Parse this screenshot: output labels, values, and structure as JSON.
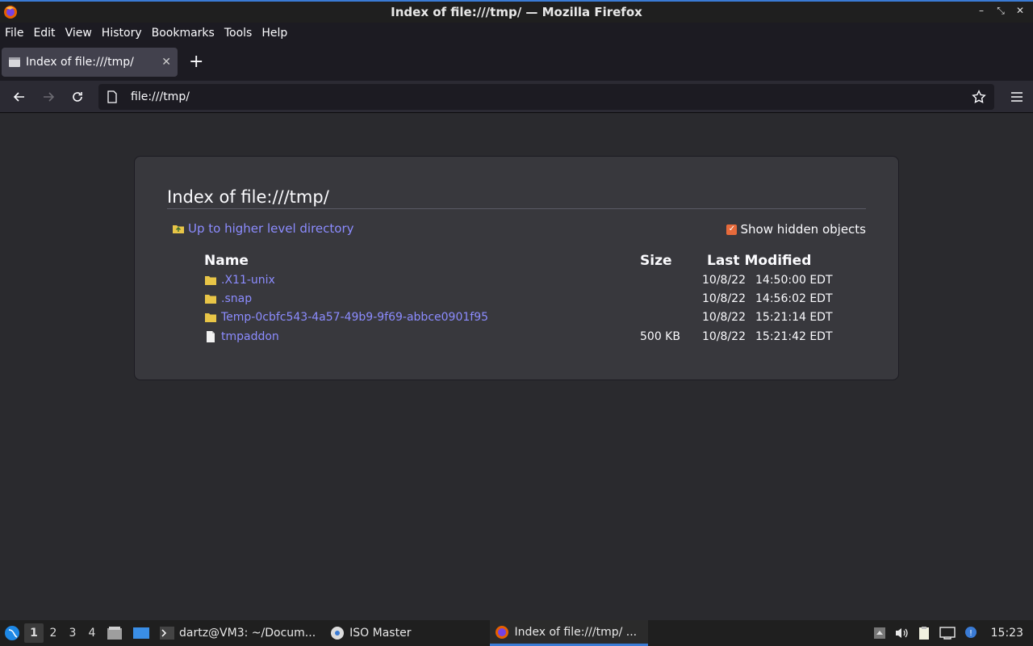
{
  "window": {
    "title": "Index of file:///tmp/ — Mozilla Firefox",
    "controls": [
      "–",
      "⤡",
      "✕"
    ]
  },
  "menubar": {
    "items": [
      "File",
      "Edit",
      "View",
      "History",
      "Bookmarks",
      "Tools",
      "Help"
    ]
  },
  "tab": {
    "label": "Index of file:///tmp/",
    "close": "✕",
    "new_tab": "+"
  },
  "navbar": {
    "url": "file:///tmp/"
  },
  "page": {
    "heading": "Index of file:///tmp/",
    "up_link": "Up to higher level directory",
    "show_hidden_label": "Show hidden objects",
    "show_hidden_checked": true,
    "columns": {
      "name": "Name",
      "size": "Size",
      "modified": "Last Modified"
    },
    "entries": [
      {
        "name": ".X11-unix",
        "type": "folder",
        "size": "",
        "date": "10/8/22",
        "time": "14:50:00 EDT"
      },
      {
        "name": ".snap",
        "type": "folder",
        "size": "",
        "date": "10/8/22",
        "time": "14:56:02 EDT"
      },
      {
        "name": "Temp-0cbfc543-4a57-49b9-9f69-abbce0901f95",
        "type": "folder",
        "size": "",
        "date": "10/8/22",
        "time": "15:21:14 EDT"
      },
      {
        "name": "tmpaddon",
        "type": "file",
        "size": "500 KB",
        "date": "10/8/22",
        "time": "15:21:42 EDT"
      }
    ]
  },
  "taskbar": {
    "workspaces": [
      "1",
      "2",
      "3",
      "4"
    ],
    "tasks": [
      {
        "label": "dartz@VM3: ~/Docum...",
        "icon": "terminal-icon"
      },
      {
        "label": "ISO Master",
        "icon": "iso-master-icon"
      },
      {
        "label": "Index of file:///tmp/ ...",
        "icon": "firefox-icon"
      }
    ],
    "clock": "15:23"
  },
  "colors": {
    "link": "#8c8cff",
    "accent": "#3a7bd5",
    "checkbox": "#e66a3b"
  }
}
